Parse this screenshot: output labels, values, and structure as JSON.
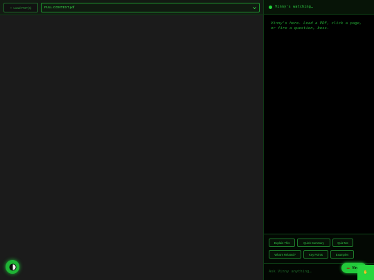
{
  "toolbar": {
    "load_icon": "plus-icon",
    "load_label": "Load PDF(s)",
    "file_selected": "FULL CONTEXT.pdf"
  },
  "chat": {
    "status": "Vinny's watching…",
    "welcome": "Vinny's here. Load a PDF, click a page, or fire a question, boss.",
    "actions": [
      "Explain This",
      "Quick Summary",
      "Quiz Me",
      "What's Related?",
      "Key Points",
      "Examples"
    ],
    "input_placeholder": "Ask Vinny anything…"
  },
  "floating": {
    "theme_icon": "half-circle-icon",
    "assistant_label": "Vinny",
    "assistant_icon": "cigar-icon",
    "corner_icon": "hand-icon",
    "corner_glyph": "✋"
  },
  "colors": {
    "accent": "#22d33a",
    "panel": "#000000",
    "canvas": "#1b1b1b"
  }
}
